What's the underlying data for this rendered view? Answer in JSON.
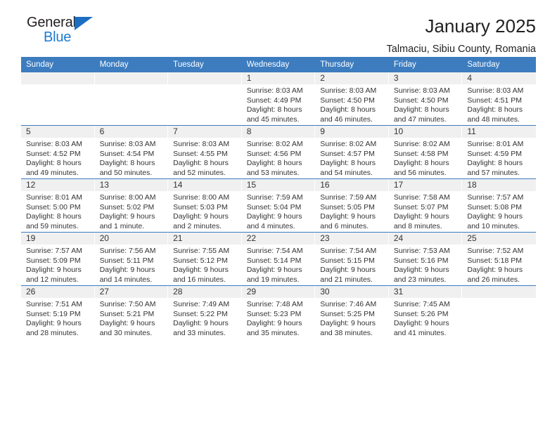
{
  "logo": {
    "word_top": "General",
    "word_bottom": "Blue",
    "triangle_color": "#1b6ec2",
    "blue_color": "#1b7bd0"
  },
  "header": {
    "title": "January 2025",
    "subtitle": "Talmaciu, Sibiu County, Romania"
  },
  "theme": {
    "header_blue": "#3c7cbf",
    "daynum_band": "#f0f0f0",
    "text": "#333333"
  },
  "calendar": {
    "weekday_headers": [
      "Sunday",
      "Monday",
      "Tuesday",
      "Wednesday",
      "Thursday",
      "Friday",
      "Saturday"
    ],
    "weeks": [
      [
        {
          "day": "",
          "empty": true
        },
        {
          "day": "",
          "empty": true
        },
        {
          "day": "",
          "empty": true
        },
        {
          "day": "1",
          "sunrise": "Sunrise: 8:03 AM",
          "sunset": "Sunset: 4:49 PM",
          "daylight_1": "Daylight: 8 hours",
          "daylight_2": "and 45 minutes."
        },
        {
          "day": "2",
          "sunrise": "Sunrise: 8:03 AM",
          "sunset": "Sunset: 4:50 PM",
          "daylight_1": "Daylight: 8 hours",
          "daylight_2": "and 46 minutes."
        },
        {
          "day": "3",
          "sunrise": "Sunrise: 8:03 AM",
          "sunset": "Sunset: 4:50 PM",
          "daylight_1": "Daylight: 8 hours",
          "daylight_2": "and 47 minutes."
        },
        {
          "day": "4",
          "sunrise": "Sunrise: 8:03 AM",
          "sunset": "Sunset: 4:51 PM",
          "daylight_1": "Daylight: 8 hours",
          "daylight_2": "and 48 minutes."
        }
      ],
      [
        {
          "day": "5",
          "sunrise": "Sunrise: 8:03 AM",
          "sunset": "Sunset: 4:52 PM",
          "daylight_1": "Daylight: 8 hours",
          "daylight_2": "and 49 minutes."
        },
        {
          "day": "6",
          "sunrise": "Sunrise: 8:03 AM",
          "sunset": "Sunset: 4:54 PM",
          "daylight_1": "Daylight: 8 hours",
          "daylight_2": "and 50 minutes."
        },
        {
          "day": "7",
          "sunrise": "Sunrise: 8:03 AM",
          "sunset": "Sunset: 4:55 PM",
          "daylight_1": "Daylight: 8 hours",
          "daylight_2": "and 52 minutes."
        },
        {
          "day": "8",
          "sunrise": "Sunrise: 8:02 AM",
          "sunset": "Sunset: 4:56 PM",
          "daylight_1": "Daylight: 8 hours",
          "daylight_2": "and 53 minutes."
        },
        {
          "day": "9",
          "sunrise": "Sunrise: 8:02 AM",
          "sunset": "Sunset: 4:57 PM",
          "daylight_1": "Daylight: 8 hours",
          "daylight_2": "and 54 minutes."
        },
        {
          "day": "10",
          "sunrise": "Sunrise: 8:02 AM",
          "sunset": "Sunset: 4:58 PM",
          "daylight_1": "Daylight: 8 hours",
          "daylight_2": "and 56 minutes."
        },
        {
          "day": "11",
          "sunrise": "Sunrise: 8:01 AM",
          "sunset": "Sunset: 4:59 PM",
          "daylight_1": "Daylight: 8 hours",
          "daylight_2": "and 57 minutes."
        }
      ],
      [
        {
          "day": "12",
          "sunrise": "Sunrise: 8:01 AM",
          "sunset": "Sunset: 5:00 PM",
          "daylight_1": "Daylight: 8 hours",
          "daylight_2": "and 59 minutes."
        },
        {
          "day": "13",
          "sunrise": "Sunrise: 8:00 AM",
          "sunset": "Sunset: 5:02 PM",
          "daylight_1": "Daylight: 9 hours",
          "daylight_2": "and 1 minute."
        },
        {
          "day": "14",
          "sunrise": "Sunrise: 8:00 AM",
          "sunset": "Sunset: 5:03 PM",
          "daylight_1": "Daylight: 9 hours",
          "daylight_2": "and 2 minutes."
        },
        {
          "day": "15",
          "sunrise": "Sunrise: 7:59 AM",
          "sunset": "Sunset: 5:04 PM",
          "daylight_1": "Daylight: 9 hours",
          "daylight_2": "and 4 minutes."
        },
        {
          "day": "16",
          "sunrise": "Sunrise: 7:59 AM",
          "sunset": "Sunset: 5:05 PM",
          "daylight_1": "Daylight: 9 hours",
          "daylight_2": "and 6 minutes."
        },
        {
          "day": "17",
          "sunrise": "Sunrise: 7:58 AM",
          "sunset": "Sunset: 5:07 PM",
          "daylight_1": "Daylight: 9 hours",
          "daylight_2": "and 8 minutes."
        },
        {
          "day": "18",
          "sunrise": "Sunrise: 7:57 AM",
          "sunset": "Sunset: 5:08 PM",
          "daylight_1": "Daylight: 9 hours",
          "daylight_2": "and 10 minutes."
        }
      ],
      [
        {
          "day": "19",
          "sunrise": "Sunrise: 7:57 AM",
          "sunset": "Sunset: 5:09 PM",
          "daylight_1": "Daylight: 9 hours",
          "daylight_2": "and 12 minutes."
        },
        {
          "day": "20",
          "sunrise": "Sunrise: 7:56 AM",
          "sunset": "Sunset: 5:11 PM",
          "daylight_1": "Daylight: 9 hours",
          "daylight_2": "and 14 minutes."
        },
        {
          "day": "21",
          "sunrise": "Sunrise: 7:55 AM",
          "sunset": "Sunset: 5:12 PM",
          "daylight_1": "Daylight: 9 hours",
          "daylight_2": "and 16 minutes."
        },
        {
          "day": "22",
          "sunrise": "Sunrise: 7:54 AM",
          "sunset": "Sunset: 5:14 PM",
          "daylight_1": "Daylight: 9 hours",
          "daylight_2": "and 19 minutes."
        },
        {
          "day": "23",
          "sunrise": "Sunrise: 7:54 AM",
          "sunset": "Sunset: 5:15 PM",
          "daylight_1": "Daylight: 9 hours",
          "daylight_2": "and 21 minutes."
        },
        {
          "day": "24",
          "sunrise": "Sunrise: 7:53 AM",
          "sunset": "Sunset: 5:16 PM",
          "daylight_1": "Daylight: 9 hours",
          "daylight_2": "and 23 minutes."
        },
        {
          "day": "25",
          "sunrise": "Sunrise: 7:52 AM",
          "sunset": "Sunset: 5:18 PM",
          "daylight_1": "Daylight: 9 hours",
          "daylight_2": "and 26 minutes."
        }
      ],
      [
        {
          "day": "26",
          "sunrise": "Sunrise: 7:51 AM",
          "sunset": "Sunset: 5:19 PM",
          "daylight_1": "Daylight: 9 hours",
          "daylight_2": "and 28 minutes."
        },
        {
          "day": "27",
          "sunrise": "Sunrise: 7:50 AM",
          "sunset": "Sunset: 5:21 PM",
          "daylight_1": "Daylight: 9 hours",
          "daylight_2": "and 30 minutes."
        },
        {
          "day": "28",
          "sunrise": "Sunrise: 7:49 AM",
          "sunset": "Sunset: 5:22 PM",
          "daylight_1": "Daylight: 9 hours",
          "daylight_2": "and 33 minutes."
        },
        {
          "day": "29",
          "sunrise": "Sunrise: 7:48 AM",
          "sunset": "Sunset: 5:23 PM",
          "daylight_1": "Daylight: 9 hours",
          "daylight_2": "and 35 minutes."
        },
        {
          "day": "30",
          "sunrise": "Sunrise: 7:46 AM",
          "sunset": "Sunset: 5:25 PM",
          "daylight_1": "Daylight: 9 hours",
          "daylight_2": "and 38 minutes."
        },
        {
          "day": "31",
          "sunrise": "Sunrise: 7:45 AM",
          "sunset": "Sunset: 5:26 PM",
          "daylight_1": "Daylight: 9 hours",
          "daylight_2": "and 41 minutes."
        },
        {
          "day": "",
          "empty": true
        }
      ]
    ]
  }
}
